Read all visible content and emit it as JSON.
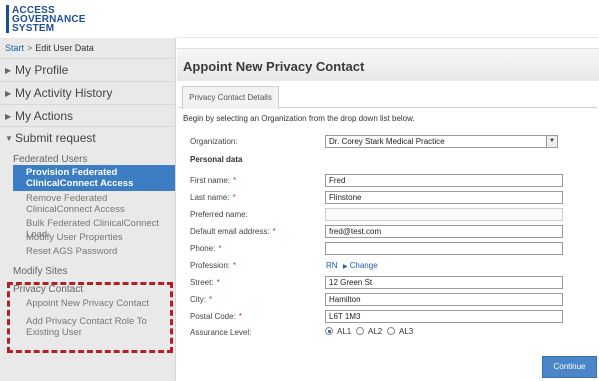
{
  "logo": {
    "lines": [
      "ACCESS",
      "GOVERNANCE",
      "SYSTEM"
    ]
  },
  "breadcrumb": {
    "start": "Start",
    "separator": ">",
    "current": "Edit User Data"
  },
  "sidebar": {
    "menu": [
      {
        "label": "My Profile",
        "expanded": false
      },
      {
        "label": "My Activity History",
        "expanded": false
      },
      {
        "label": "My Actions",
        "expanded": false
      },
      {
        "label": "Submit request",
        "expanded": true
      }
    ],
    "federated_users": {
      "heading": "Federated Users",
      "items": [
        {
          "label": "Provision Federated ClinicalConnect Access",
          "active": true
        },
        {
          "label": "Remove Federated ClinicalConnect Access",
          "active": false
        },
        {
          "label": "Bulk Federated ClinicalConnect Load",
          "active": false
        },
        {
          "label": "Modify User Properties",
          "active": false
        },
        {
          "label": "Reset AGS Password",
          "active": false
        }
      ]
    },
    "modify_sites": {
      "heading": "Modify Sites"
    },
    "privacy_contact": {
      "heading": "Privacy Contact",
      "items": [
        {
          "label": "Appoint New Privacy Contact"
        },
        {
          "label": "Add Privacy Contact Role To Existing User"
        }
      ]
    },
    "highlight_color": "#b41f24"
  },
  "main": {
    "title": "Appoint New Privacy Contact",
    "tab": "Privacy Contact Details",
    "intro": "Begin by selecting an Organization from the drop down list below.",
    "organization": {
      "label": "Organization:",
      "value": "Dr. Corey Stark Medical Practice"
    },
    "personal_data_label": "Personal data",
    "fields": {
      "first_name": {
        "label": "First name:",
        "required": true,
        "value": "Fred"
      },
      "last_name": {
        "label": "Last name:",
        "required": true,
        "value": "Flinstone"
      },
      "preferred_name": {
        "label": "Preferred name:",
        "required": false,
        "value": ""
      },
      "email": {
        "label": "Default email address:",
        "required": true,
        "value": "fred@test.com"
      },
      "phone": {
        "label": "Phone:",
        "required": true,
        "value": ""
      },
      "profession": {
        "label": "Profession:",
        "required": true,
        "value": "RN",
        "change_label": "Change"
      },
      "street": {
        "label": "Street:",
        "required": true,
        "value": "12 Green St"
      },
      "city": {
        "label": "City:",
        "required": true,
        "value": "Hamilton"
      },
      "postal_code": {
        "label": "Postal Code:",
        "required": true,
        "value": "L6T 1M3"
      }
    },
    "assurance": {
      "label": "Assurance Level:",
      "options": [
        "AL1",
        "AL2",
        "AL3"
      ],
      "selected": "AL1"
    },
    "continue_label": "Continue",
    "required_marker": "*",
    "accent_color": "#4a86c8"
  }
}
